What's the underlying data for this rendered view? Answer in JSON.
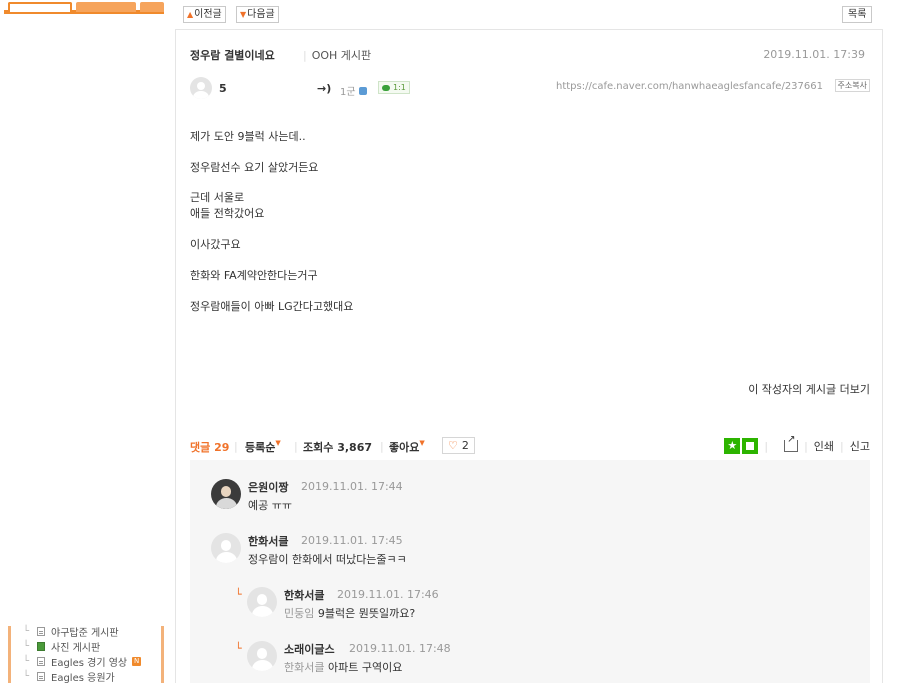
{
  "nav": {
    "prev_label": "이전글",
    "next_label": "다음글",
    "list_label": "목록"
  },
  "sidebar": {
    "items": [
      {
        "label": "야구탑준 게시판",
        "icon": "doc-icon",
        "new": false
      },
      {
        "label": "사진 게시판",
        "icon": "photo-icon",
        "new": false
      },
      {
        "label": "Eagles 경기 영상",
        "icon": "doc-icon",
        "new": true,
        "badge": "N"
      },
      {
        "label": "Eagles 응원가",
        "icon": "doc-icon",
        "new": false
      }
    ]
  },
  "post": {
    "title": "정우람 결별이네요",
    "board": "OOH 게시판",
    "date": "2019.11.01. 17:39",
    "author_nick": "5",
    "author_arrow": "→)",
    "author_level": "1군",
    "chat_label": "1:1",
    "url": "https://cafe.naver.com/hanwhaeaglesfancafe/237661",
    "copy_label": "주소복사",
    "body": [
      "제가 도안 9블럭 사는데..",
      "정우람선수 요기 살았거든요",
      "근데 서울로",
      "애들 전학갔어요",
      "이사갔구요",
      "한화와 FA계약안한다는거구",
      "정우람애들이 아빠 LG간다고했대요"
    ],
    "more_label": "이 작성자의 게시글 더보기"
  },
  "comment_bar": {
    "label": "댓글",
    "count": "29",
    "order_label": "등록순",
    "views_label": "조회수",
    "views_count": "3,867",
    "like_label": "좋아요",
    "like_count": "2",
    "print_label": "인쇄",
    "report_label": "신고"
  },
  "comments": [
    {
      "nick": "은원이짱",
      "date": "2019.11.01. 17:44",
      "text": "예공 ㅠㅠ",
      "reply": false
    },
    {
      "nick": "한화서클",
      "date": "2019.11.01. 17:45",
      "text": "정우람이 한화에서 떠났다는줄ㅋㅋ",
      "reply": false
    },
    {
      "nick": "한화서클",
      "date": "2019.11.01. 17:46",
      "ref": "민둥임",
      "text": "9블럭은 뭔뜻일까요?",
      "reply": true
    },
    {
      "nick": "소래이글스",
      "date": "2019.11.01. 17:48",
      "ref": "한화서클",
      "text": "아파트 구역이요",
      "reply": true
    }
  ],
  "colors": {
    "accent": "#f0722a",
    "green": "#2db400",
    "border": "#e5e5e5"
  }
}
